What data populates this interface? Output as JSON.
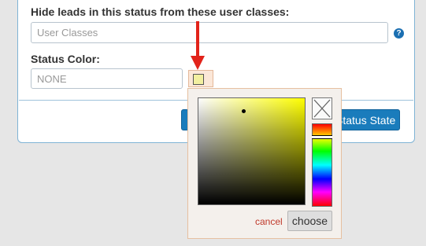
{
  "form": {
    "hide_leads_label": "Hide leads in this status from these user classes:",
    "user_classes_placeholder": "User Classes",
    "help_icon_glyph": "?",
    "status_color_label": "Status Color:",
    "status_color_value": "NONE",
    "swatch_color": "#f2efa0",
    "submit_label": "Status State"
  },
  "color_picker": {
    "selected_hue": "#ffff00",
    "cancel_label": "cancel",
    "choose_label": "choose"
  },
  "colors": {
    "accent_blue": "#1a7cbc",
    "cancel_red": "#c0392b",
    "arrow_red": "#e2231a"
  },
  "icons": {
    "help": "question-circle-icon",
    "no_color": "x-icon",
    "arrow": "arrow-down-icon"
  }
}
